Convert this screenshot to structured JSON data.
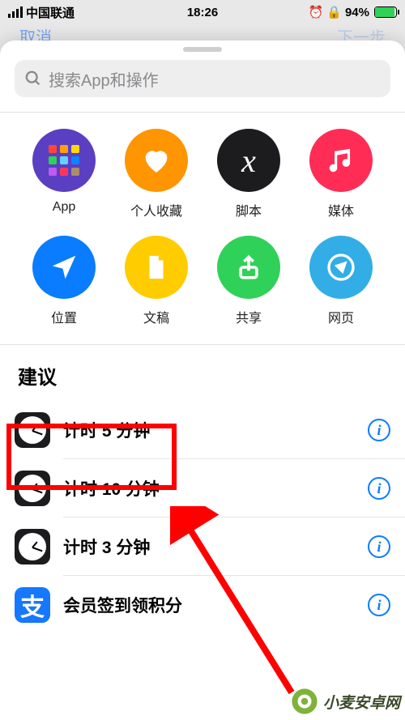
{
  "status": {
    "carrier": "中国联通",
    "time": "18:26",
    "battery_pct": "94%"
  },
  "dimmed": {
    "left": "取消",
    "right": "下一步"
  },
  "search": {
    "placeholder": "搜索App和操作"
  },
  "categories": [
    {
      "label": "App",
      "color": "#5b3fc2",
      "icon": "app-grid"
    },
    {
      "label": "个人收藏",
      "color": "#ff9500",
      "icon": "heart"
    },
    {
      "label": "脚本",
      "color": "#1c1c1e",
      "icon": "script"
    },
    {
      "label": "媒体",
      "color": "#ff2d55",
      "icon": "music"
    },
    {
      "label": "位置",
      "color": "#0a7cff",
      "icon": "location"
    },
    {
      "label": "文稿",
      "color": "#ffcc00",
      "icon": "document"
    },
    {
      "label": "共享",
      "color": "#30d158",
      "icon": "share"
    },
    {
      "label": "网页",
      "color": "#32ade6",
      "icon": "compass"
    }
  ],
  "suggestions": {
    "title": "建议",
    "items": [
      {
        "icon": "clock",
        "label": "计时 5 分钟"
      },
      {
        "icon": "clock",
        "label": "计时 10 分钟"
      },
      {
        "icon": "clock",
        "label": "计时 3 分钟"
      },
      {
        "icon": "alipay",
        "label": "会员签到领积分"
      }
    ]
  },
  "watermark": {
    "text": "小麦安卓网"
  }
}
